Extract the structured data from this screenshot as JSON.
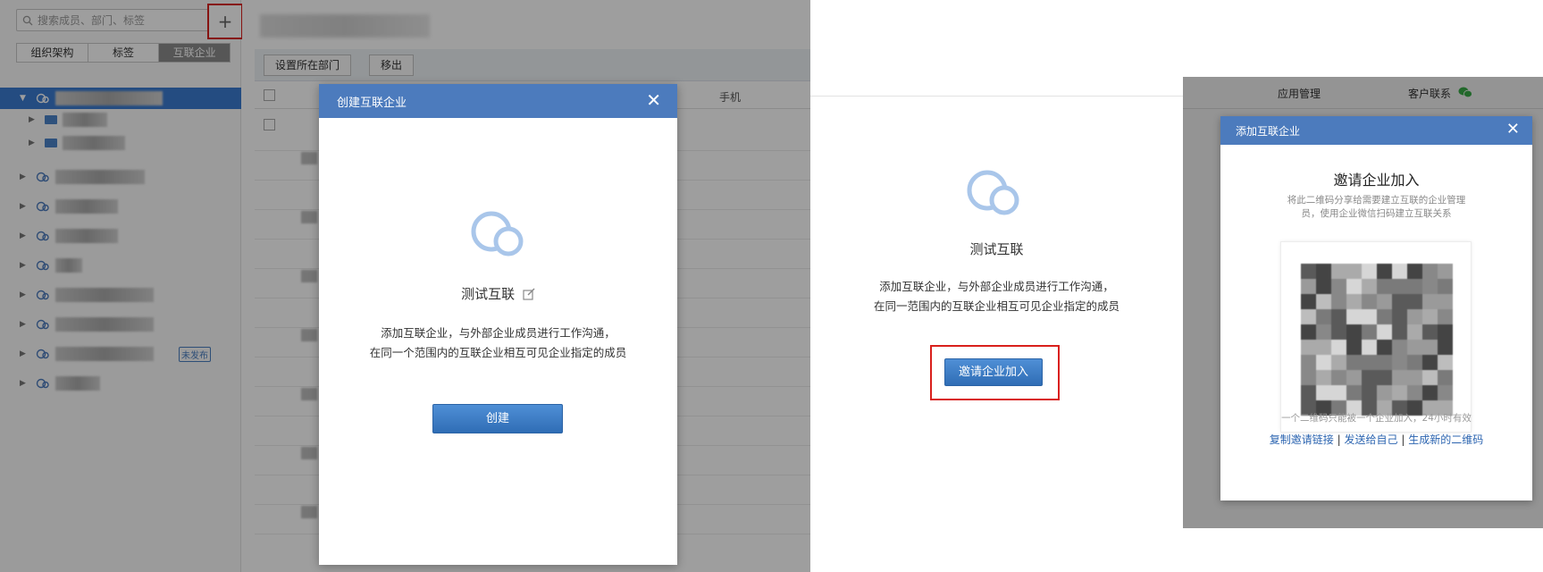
{
  "panel1": {
    "search": {
      "placeholder": "搜索成员、部门、标签"
    },
    "add_button": "+",
    "segments": [
      "组织架构",
      "标签",
      "互联企业"
    ],
    "tree": {
      "unpublished_badge": "未发布"
    },
    "toolbar": {
      "set_dept": "设置所在部门",
      "remove": "移出"
    },
    "table": {
      "col_phone": "手机"
    },
    "dialog": {
      "title": "创建互联企业",
      "close": "✕",
      "name": "测试互联",
      "desc_line1": "添加互联企业，与外部企业成员进行工作沟通，",
      "desc_line2": "在同一个范围内的互联企业相互可见企业指定的成员",
      "create_button": "创建"
    }
  },
  "panel2": {
    "name": "测试互联",
    "desc_line1": "添加互联企业，与外部企业成员进行工作沟通，",
    "desc_line2": "在同一范围内的互联企业相互可见企业指定的成员",
    "invite_button": "邀请企业加入"
  },
  "panel3": {
    "tabs": [
      "应用管理",
      "客户联系"
    ],
    "dialog": {
      "title": "添加互联企业",
      "close": "✕",
      "heading": "邀请企业加入",
      "desc_line1": "将此二维码分享给需要建立互联的企业管理",
      "desc_line2": "员，使用企业微信扫码建立互联关系",
      "qr_note": "一个二维码只能被一个企业加入，24小时有效",
      "links": [
        "复制邀请链接",
        "发送给自己",
        "生成新的二维码"
      ],
      "separator": "|"
    }
  },
  "colors": {
    "accent_blue": "#4c7bbd",
    "button_blue": "#2f6db5",
    "highlight_red": "#d9201c"
  }
}
